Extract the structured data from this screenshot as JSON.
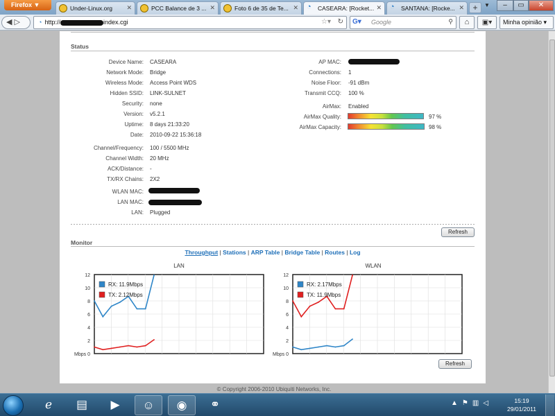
{
  "browser": {
    "menu_label": "Firefox ▼",
    "tabs": [
      {
        "title": "Under-Linux.org"
      },
      {
        "title": "PCC Balance de 3 ..."
      },
      {
        "title": "Foto 6 de 35 de Te..."
      },
      {
        "title": "CASEARA: [Rocket..."
      },
      {
        "title": "SANTANA: [Rocke..."
      }
    ],
    "new_tab": "+",
    "url_prefix": "http://",
    "url_suffix": "index.cgi",
    "search_placeholder": "Google",
    "opinion_label": "Minha opinião ▾"
  },
  "status": {
    "section_title": "Status",
    "left_rows": [
      {
        "label": "Device Name:",
        "value": "CASEARA"
      },
      {
        "label": "Network Mode:",
        "value": "Bridge"
      },
      {
        "label": "Wireless Mode:",
        "value": "Access Point WDS"
      },
      {
        "label": "Hidden SSID:",
        "value": "LINK-SULNET"
      },
      {
        "label": "Security:",
        "value": "none"
      },
      {
        "label": "Version:",
        "value": "v5.2.1"
      },
      {
        "label": "Uptime:",
        "value": "8 days 21:33:20"
      },
      {
        "label": "Date:",
        "value": "2010-09-22 15:36:18"
      },
      {
        "label": "Channel/Frequency:",
        "value": "100 / 5500 MHz"
      },
      {
        "label": "Channel Width:",
        "value": "20 MHz"
      },
      {
        "label": "ACK/Distance:",
        "value": "-"
      },
      {
        "label": "TX/RX Chains:",
        "value": "2X2"
      },
      {
        "label": "WLAN MAC:",
        "value": ""
      },
      {
        "label": "LAN MAC:",
        "value": ""
      },
      {
        "label": "LAN:",
        "value": "Plugged"
      }
    ],
    "right_rows": [
      {
        "label": "AP MAC:",
        "value": ""
      },
      {
        "label": "Connections:",
        "value": "1"
      },
      {
        "label": "Noise Floor:",
        "value": "-91 dBm"
      },
      {
        "label": "Transmit CCQ:",
        "value": "100 %"
      },
      {
        "label": "AirMax:",
        "value": "Enabled"
      }
    ],
    "airmax_quality": {
      "label": "AirMax Quality:",
      "percent": 97,
      "text": "97 %"
    },
    "airmax_capacity": {
      "label": "AirMax Capacity:",
      "percent": 98,
      "text": "98 %"
    },
    "refresh_label": "Refresh"
  },
  "monitor": {
    "section_title": "Monitor",
    "links": [
      "Throughput",
      "Stations",
      "ARP Table",
      "Bridge Table",
      "Routes",
      "Log"
    ],
    "separator": "|",
    "refresh_label": "Refresh"
  },
  "chart_data": [
    {
      "type": "line",
      "title": "LAN",
      "ylabel": "Mbps",
      "ylim": [
        0,
        12
      ],
      "yticks": [
        0,
        2,
        4,
        6,
        8,
        10,
        12
      ],
      "grid": true,
      "legend_position": "top-left",
      "x": [
        0,
        1,
        2,
        3,
        4,
        5,
        6,
        7
      ],
      "series": [
        {
          "name": "RX: 11.9Mbps",
          "color": "#2f86c8",
          "values": [
            8.0,
            5.6,
            7.2,
            7.8,
            8.7,
            6.8,
            6.8,
            11.9
          ]
        },
        {
          "name": "TX: 2.12Mbps",
          "color": "#e02020",
          "values": [
            1.0,
            0.6,
            0.8,
            1.0,
            1.2,
            1.0,
            1.2,
            2.1
          ]
        }
      ]
    },
    {
      "type": "line",
      "title": "WLAN",
      "ylabel": "Mbps",
      "ylim": [
        0,
        12
      ],
      "yticks": [
        0,
        2,
        4,
        6,
        8,
        10,
        12
      ],
      "grid": true,
      "legend_position": "top-left",
      "x": [
        0,
        1,
        2,
        3,
        4,
        5,
        6,
        7
      ],
      "series": [
        {
          "name": "RX: 2.17Mbps",
          "color": "#2f86c8",
          "values": [
            1.0,
            0.6,
            0.8,
            1.0,
            1.2,
            1.0,
            1.2,
            2.2
          ]
        },
        {
          "name": "TX: 11.9Mbps",
          "color": "#e02020",
          "values": [
            8.0,
            5.6,
            7.2,
            7.8,
            8.7,
            6.8,
            6.8,
            11.9
          ]
        }
      ]
    }
  ],
  "footer": "© Copyright 2006-2010 Ubiquiti Networks, Inc.",
  "taskbar": {
    "time": "15:19",
    "date": "29/01/2011"
  }
}
